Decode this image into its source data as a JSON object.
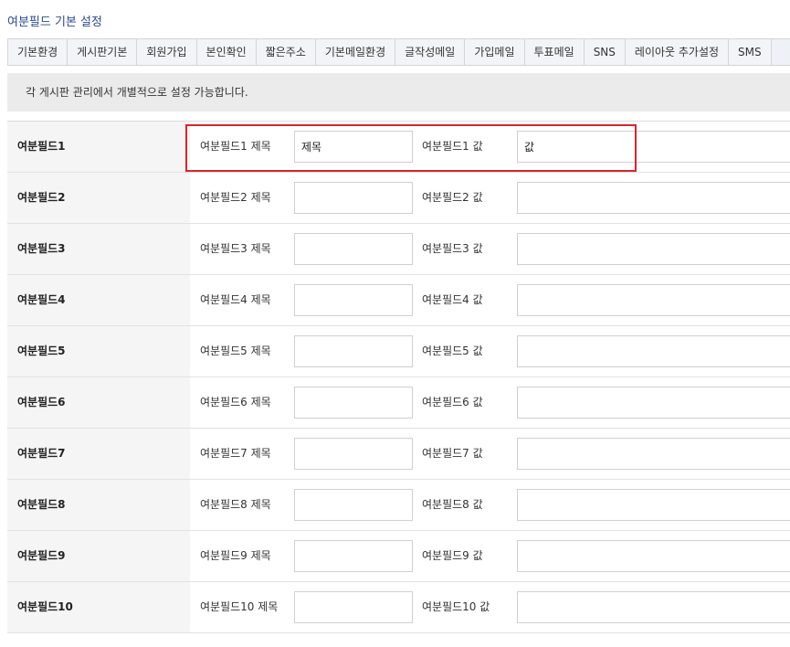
{
  "page_title": "여분필드 기본 설정",
  "tabs": [
    "기본환경",
    "게시판기본",
    "회원가입",
    "본인확인",
    "짧은주소",
    "기본메일환경",
    "글작성메일",
    "가입메일",
    "투표메일",
    "SNS",
    "레이아웃 추가설정",
    "SMS"
  ],
  "notice": "각 게시판 관리에서 개별적으로 설정 가능합니다.",
  "highlight_color": "#d6262d",
  "fields": [
    {
      "name": "여분필드1",
      "title_label": "여분필드1 제목",
      "title_value": "제목",
      "value_label": "여분필드1 값",
      "value_value": "값"
    },
    {
      "name": "여분필드2",
      "title_label": "여분필드2 제목",
      "title_value": "",
      "value_label": "여분필드2 값",
      "value_value": ""
    },
    {
      "name": "여분필드3",
      "title_label": "여분필드3 제목",
      "title_value": "",
      "value_label": "여분필드3 값",
      "value_value": ""
    },
    {
      "name": "여분필드4",
      "title_label": "여분필드4 제목",
      "title_value": "",
      "value_label": "여분필드4 값",
      "value_value": ""
    },
    {
      "name": "여분필드5",
      "title_label": "여분필드5 제목",
      "title_value": "",
      "value_label": "여분필드5 값",
      "value_value": ""
    },
    {
      "name": "여분필드6",
      "title_label": "여분필드6 제목",
      "title_value": "",
      "value_label": "여분필드6 값",
      "value_value": ""
    },
    {
      "name": "여분필드7",
      "title_label": "여분필드7 제목",
      "title_value": "",
      "value_label": "여분필드7 값",
      "value_value": ""
    },
    {
      "name": "여분필드8",
      "title_label": "여분필드8 제목",
      "title_value": "",
      "value_label": "여분필드8 값",
      "value_value": ""
    },
    {
      "name": "여분필드9",
      "title_label": "여분필드9 제목",
      "title_value": "",
      "value_label": "여분필드9 값",
      "value_value": ""
    },
    {
      "name": "여분필드10",
      "title_label": "여분필드10 제목",
      "title_value": "",
      "value_label": "여분필드10 값",
      "value_value": ""
    }
  ]
}
